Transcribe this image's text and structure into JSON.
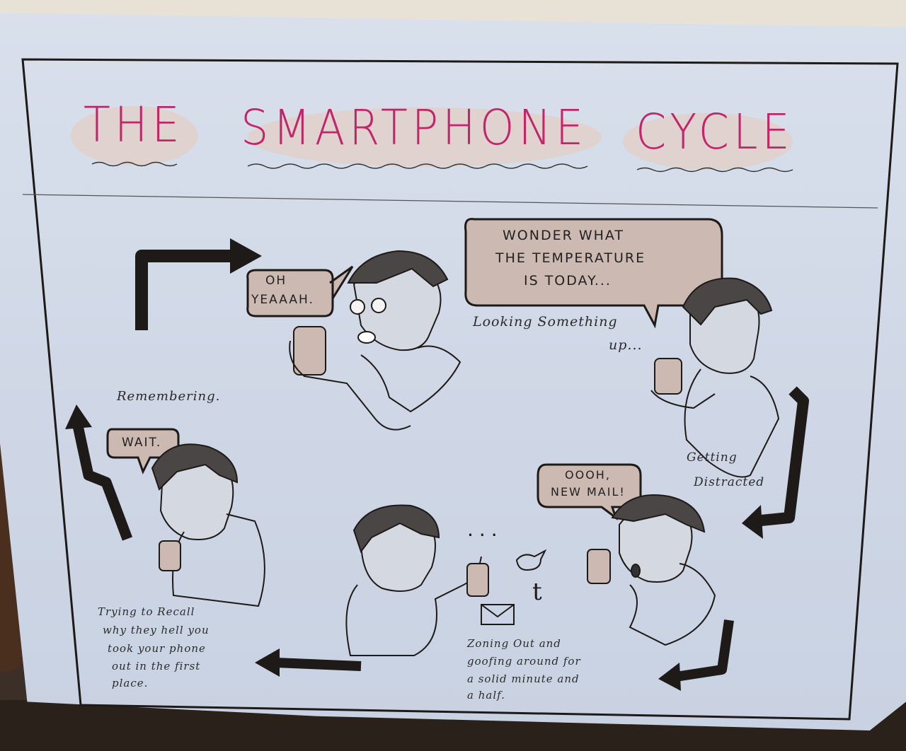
{
  "poster": {
    "title_words": [
      "THE",
      "SMARTPHONE",
      "CYCLE"
    ],
    "bubbles": {
      "oh_yeah": [
        "OH",
        "YEAAAH."
      ],
      "temperature": [
        "WONDER WHAT",
        "THE TEMPERATURE",
        "IS TODAY..."
      ],
      "wait": "WAIT.",
      "new_mail": [
        "OOOH,",
        "NEW MAIL!"
      ]
    },
    "captions": {
      "remembering": "Remembering.",
      "looking_up": [
        "Looking Something",
        "up..."
      ],
      "distracted": [
        "Getting",
        "Distracted"
      ],
      "zoning_out": [
        "Zoning Out and",
        "goofing around for",
        "a solid minute and",
        "a half."
      ],
      "recall": [
        "Trying to Recall",
        "why they hell you",
        "took your phone",
        "out in the first",
        "place."
      ]
    },
    "doodles": {
      "ellipsis": "...",
      "tumblr_letter": "t"
    }
  },
  "colors": {
    "title_pink": "#c2256a",
    "paper_blue": "#d3dae8",
    "ink": "#1e1a18",
    "bubble_fill": "#cbb9b2"
  }
}
